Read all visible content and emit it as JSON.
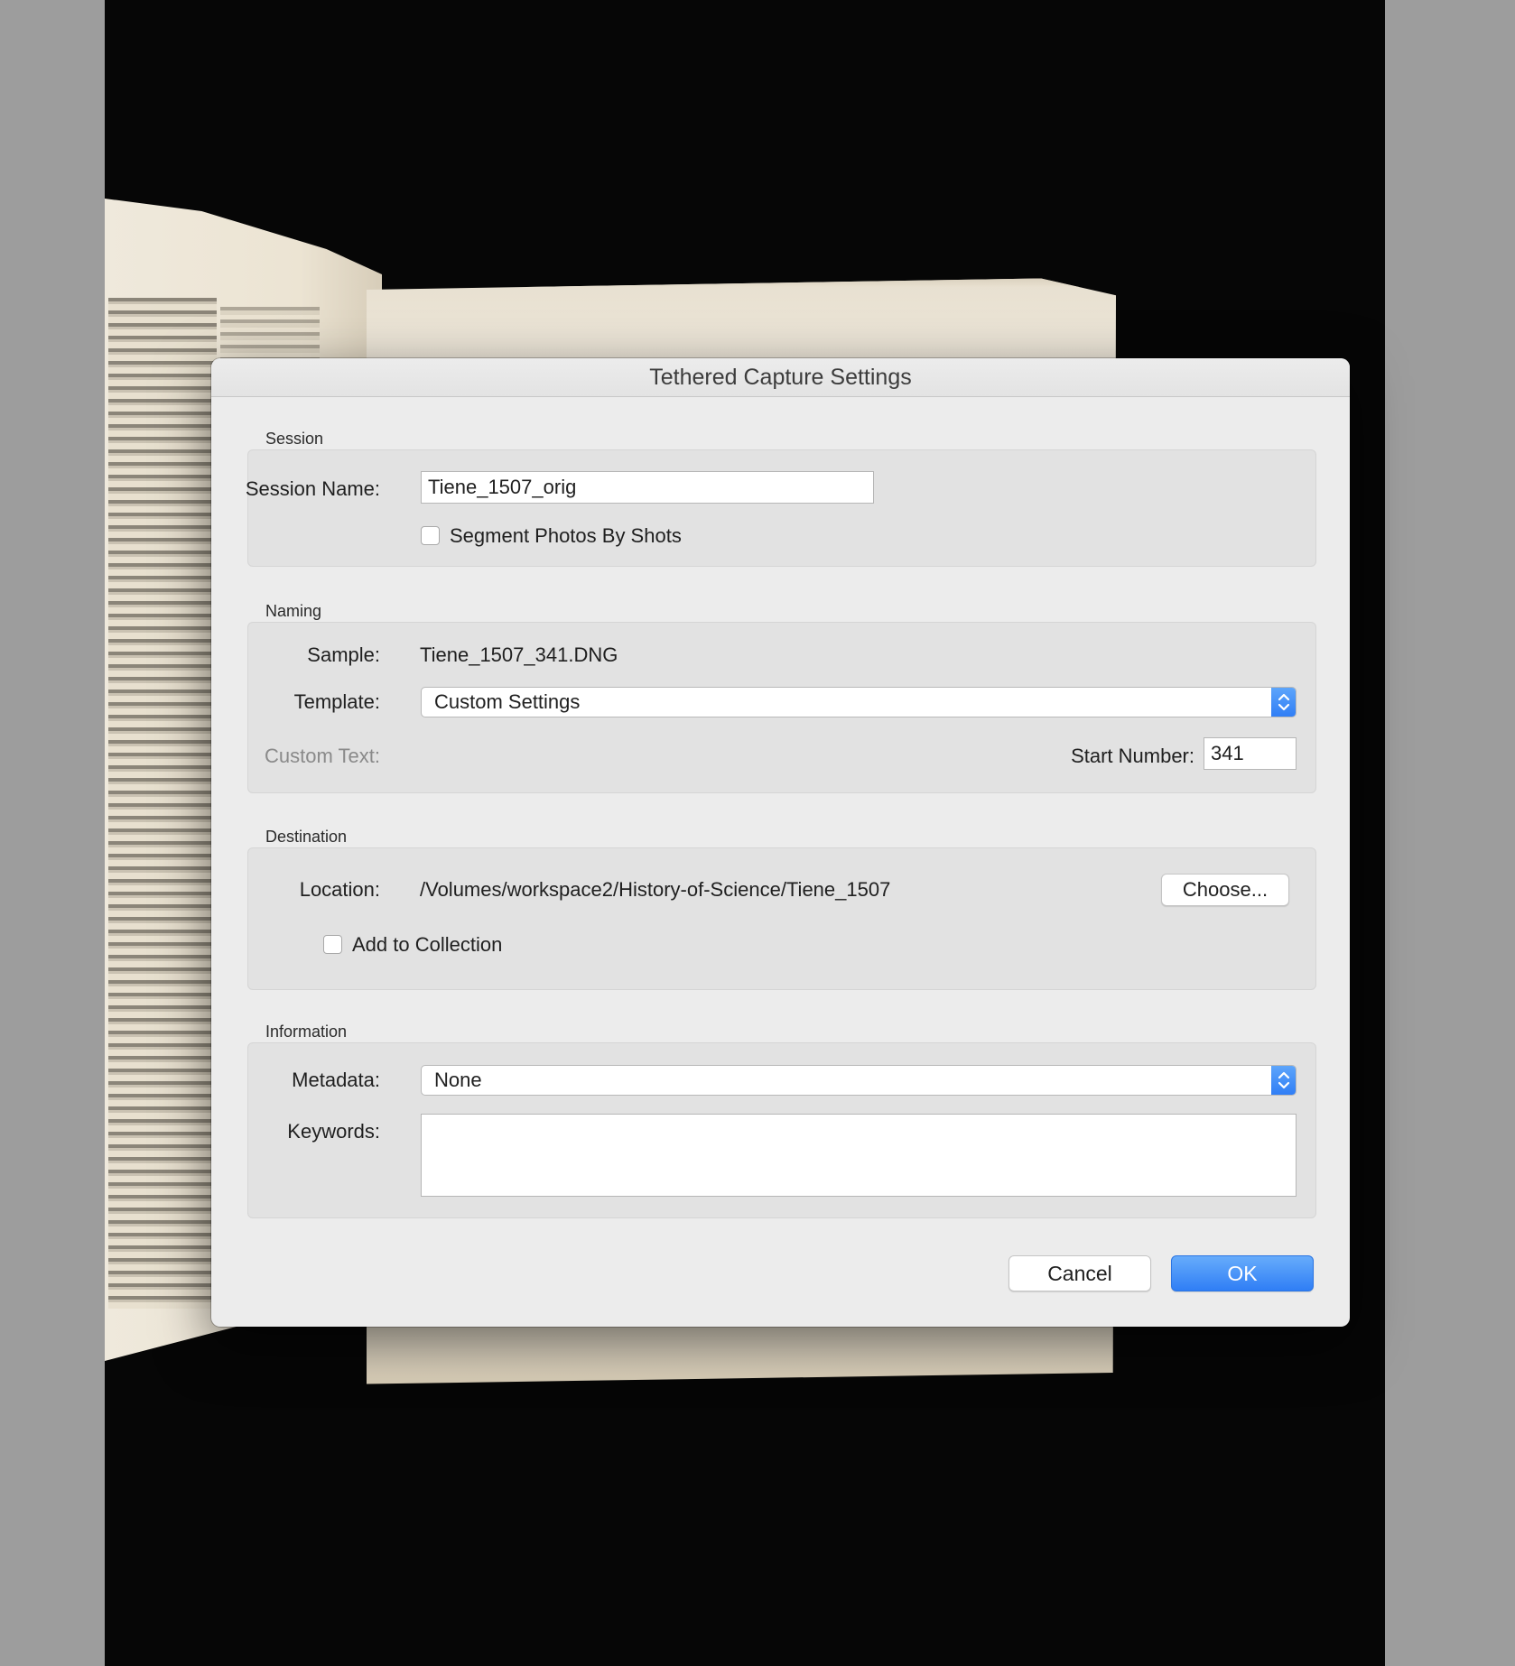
{
  "dialog": {
    "title": "Tethered Capture Settings",
    "session": {
      "section_label": "Session",
      "name_label": "Session Name:",
      "name_value": "Tiene_1507_orig",
      "segment_label": "Segment Photos By Shots",
      "segment_checked": false
    },
    "naming": {
      "section_label": "Naming",
      "sample_label": "Sample:",
      "sample_value": "Tiene_1507_341.DNG",
      "template_label": "Template:",
      "template_value": "Custom Settings",
      "custom_text_label": "Custom Text:",
      "start_number_label": "Start Number:",
      "start_number_value": "341"
    },
    "destination": {
      "section_label": "Destination",
      "location_label": "Location:",
      "location_value": "/Volumes/workspace2/History-of-Science/Tiene_1507",
      "choose_label": "Choose...",
      "add_collection_label": "Add to Collection",
      "add_collection_checked": false
    },
    "information": {
      "section_label": "Information",
      "metadata_label": "Metadata:",
      "metadata_value": "None",
      "keywords_label": "Keywords:",
      "keywords_value": ""
    },
    "buttons": {
      "cancel": "Cancel",
      "ok": "OK"
    }
  },
  "icons": {
    "select_arrows": "up-down-chevron-icon",
    "checkbox": "checkbox-icon"
  },
  "colors": {
    "accent": "#2f7ef5",
    "dialog_bg": "#ececec",
    "group_bg": "#e2e2e2"
  }
}
